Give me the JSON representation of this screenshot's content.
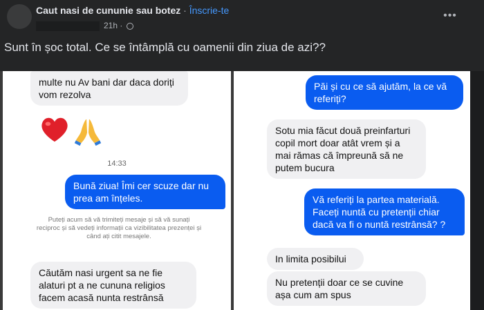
{
  "post": {
    "group_name": "Caut nasi de cununie sau botez",
    "separator": " · ",
    "join_label": "Înscrie-te",
    "time": "21h",
    "meta_sep": " · ",
    "more_label": "•••",
    "text": "Sunt în șoc total. Ce se întâmplă cu oamenii din ziua de azi??"
  },
  "screenshot": {
    "left": {
      "msg_top": "multe nu Av bani dar daca doriți vom rezolva",
      "timestamp": "14:33",
      "msg_blue": "Bună ziua! Îmi cer scuze dar nu prea am înțeles.",
      "system_note": "Puteți acum să vă trimiteți mesaje și să vă sunați reciproc și să vedeți informații ca vizibilitatea prezenței și când ați citit mesajele.",
      "msg_bottom": "Căutăm nasi urgent sa ne fie alaturi pt a ne cununa religios facem acasă nunta restrânsă"
    },
    "right": {
      "msg1": "Păi și cu ce să ajutăm, la ce vă referiți?",
      "msg2": "Sotu mia făcut două preinfarturi copil mort doar atât vrem și a mai rămas că împreună să ne putem bucura",
      "msg3": "Vă referiți la partea materială. Faceți nuntă cu pretenții chiar dacă va fi o nuntă restrânsă? ?",
      "msg4": "In limita posibilui",
      "msg5": "Nu pretenții doar ce se cuvine așa cum am spus"
    }
  },
  "icons": [
    "heart-emoji",
    "folded-hands-emoji",
    "globe-icon",
    "more-icon"
  ]
}
